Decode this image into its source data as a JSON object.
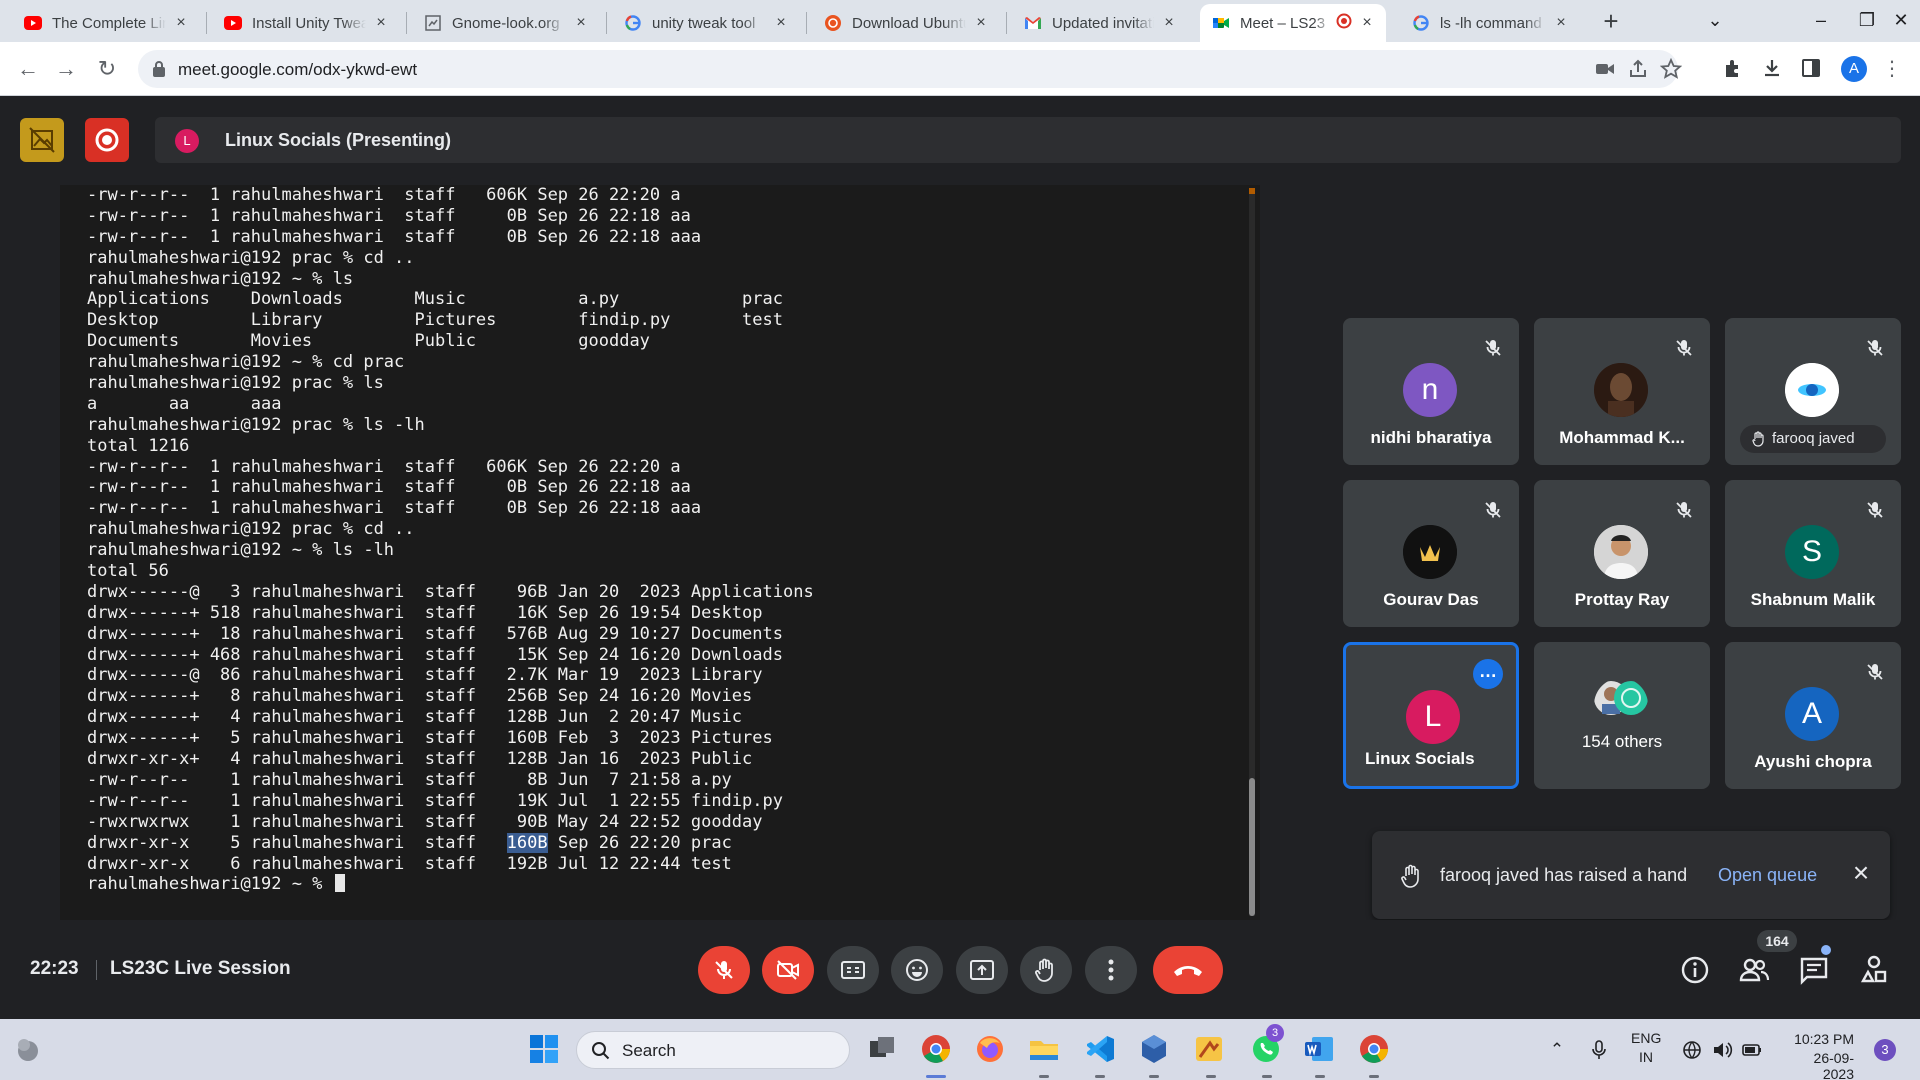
{
  "browser": {
    "tabs": [
      {
        "title": "The Complete Linux",
        "icon": "youtube-icon"
      },
      {
        "title": "Install Unity Tweak",
        "icon": "youtube-icon"
      },
      {
        "title": "Gnome-look.org",
        "icon": "gnome-look-icon"
      },
      {
        "title": "unity tweak tool",
        "icon": "google-icon"
      },
      {
        "title": "Download Ubuntu",
        "icon": "ubuntu-icon"
      },
      {
        "title": "Updated invitation",
        "icon": "gmail-icon"
      },
      {
        "title": "Meet – LS23",
        "icon": "meet-icon",
        "active": true
      },
      {
        "title": "ls -lh command",
        "icon": "google-icon"
      }
    ],
    "url": "meet.google.com/odx-ykwd-ewt",
    "profile_initial": "A"
  },
  "meet": {
    "presenting": {
      "avatar_letter": "L",
      "label": "Linux Socials (Presenting)"
    },
    "participants": [
      {
        "name": "nidhi bharatiya",
        "avatar_letter": "n",
        "avatar_color": "#7e57c2",
        "muted": true
      },
      {
        "name": "Mohammad K...",
        "avatar_letter": "",
        "avatar_color": "#3e2723",
        "muted": true
      },
      {
        "name": "farooq javed",
        "avatar_letter": "",
        "avatar_color": "#ffffff",
        "muted": true,
        "hand_raised": true
      },
      {
        "name": "Gourav Das",
        "avatar_letter": "",
        "avatar_color": "#111111",
        "muted": true
      },
      {
        "name": "Prottay Ray",
        "avatar_letter": "",
        "avatar_color": "#e0e0e0",
        "muted": true
      },
      {
        "name": "Shabnum Malik",
        "avatar_letter": "S",
        "avatar_color": "#00695c",
        "muted": true
      },
      {
        "name": "Linux Socials",
        "avatar_letter": "L",
        "avatar_color": "#d81b60",
        "muted": false,
        "selected": true
      },
      {
        "name": "154 others",
        "avatar_letter": "",
        "avatar_color": "#3c4043",
        "muted": false
      },
      {
        "name": "Ayushi chopra",
        "avatar_letter": "A",
        "avatar_color": "#1565c0",
        "muted": true
      }
    ],
    "notification": {
      "message": "farooq javed has raised a hand",
      "action": "Open queue"
    },
    "bottom": {
      "time": "22:23",
      "meeting_name": "LS23C Live Session",
      "people_count": "164"
    }
  },
  "terminal": {
    "lines": [
      "-rw-r--r--  1 rahulmaheshwari  staff   606K Sep 26 22:20 a",
      "-rw-r--r--  1 rahulmaheshwari  staff     0B Sep 26 22:18 aa",
      "-rw-r--r--  1 rahulmaheshwari  staff     0B Sep 26 22:18 aaa",
      "rahulmaheshwari@192 prac % cd ..",
      "rahulmaheshwari@192 ~ % ls",
      "Applications    Downloads       Music           a.py            prac",
      "Desktop         Library         Pictures        findip.py       test",
      "Documents       Movies          Public          goodday",
      "rahulmaheshwari@192 ~ % cd prac",
      "rahulmaheshwari@192 prac % ls",
      "a       aa      aaa",
      "rahulmaheshwari@192 prac % ls -lh",
      "total 1216",
      "-rw-r--r--  1 rahulmaheshwari  staff   606K Sep 26 22:20 a",
      "-rw-r--r--  1 rahulmaheshwari  staff     0B Sep 26 22:18 aa",
      "-rw-r--r--  1 rahulmaheshwari  staff     0B Sep 26 22:18 aaa",
      "rahulmaheshwari@192 prac % cd ..",
      "rahulmaheshwari@192 ~ % ls -lh",
      "total 56",
      "drwx------@   3 rahulmaheshwari  staff    96B Jan 20  2023 Applications",
      "drwx------+ 518 rahulmaheshwari  staff    16K Sep 26 19:54 Desktop",
      "drwx------+  18 rahulmaheshwari  staff   576B Aug 29 10:27 Documents",
      "drwx------+ 468 rahulmaheshwari  staff    15K Sep 24 16:20 Downloads",
      "drwx------@  86 rahulmaheshwari  staff   2.7K Mar 19  2023 Library",
      "drwx------+   8 rahulmaheshwari  staff   256B Sep 24 16:20 Movies",
      "drwx------+   4 rahulmaheshwari  staff   128B Jun  2 20:47 Music",
      "drwx------+   5 rahulmaheshwari  staff   160B Feb  3  2023 Pictures",
      "drwxr-xr-x+   4 rahulmaheshwari  staff   128B Jan 16  2023 Public",
      "-rw-r--r--    1 rahulmaheshwari  staff     8B Jun  7 21:58 a.py",
      "-rw-r--r--    1 rahulmaheshwari  staff    19K Jul  1 22:55 findip.py",
      "-rwxrwxrwx    1 rahulmaheshwari  staff    90B May 24 22:52 goodday",
      {
        "pre": "drwxr-xr-x    5 rahulmaheshwari  staff   ",
        "hl": "160B",
        "post": " Sep 26 22:20 prac"
      },
      "drwxr-xr-x    6 rahulmaheshwari  staff   192B Jul 12 22:44 test",
      "rahulmaheshwari@192 ~ % "
    ]
  },
  "taskbar": {
    "search_label": "Search",
    "tray": {
      "lang_top": "ENG",
      "lang_bottom": "IN",
      "time": "10:23 PM",
      "date": "26-09-2023",
      "notifications": "3",
      "whatsapp_badge": "3"
    }
  }
}
